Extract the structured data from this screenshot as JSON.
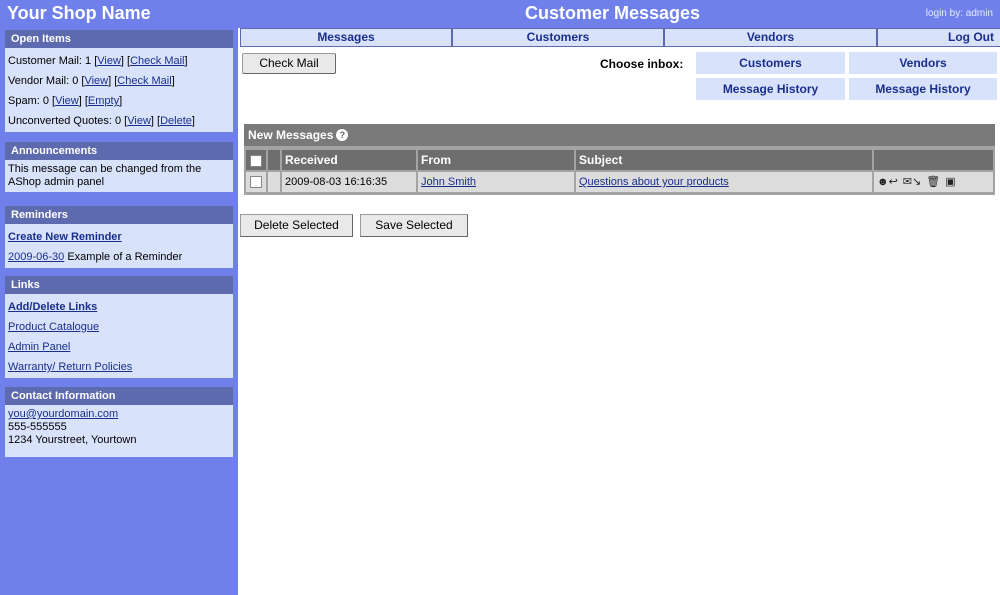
{
  "header": {
    "shop_name": "Your Shop Name",
    "page_title": "Customer Messages",
    "login": "login by: admin"
  },
  "sidebar": {
    "open_items": {
      "title": "Open Items",
      "customer_mail": "Customer Mail: 1",
      "vendor_mail": "Vendor Mail: 0",
      "spam": "Spam: 0",
      "unconverted": "Unconverted Quotes: 0",
      "view": "View",
      "check_mail": "Check Mail",
      "empty": "Empty",
      "delete": "Delete"
    },
    "announcements": {
      "title": "Announcements",
      "text": "This message can be changed from the AShop admin panel"
    },
    "reminders": {
      "title": "Reminders",
      "create": "Create New Reminder",
      "date": "2009-06-30",
      "example": "Example of a Reminder"
    },
    "links": {
      "title": "Links",
      "items": [
        "Add/Delete Links",
        "Product Catalogue",
        "Admin Panel",
        "Warranty/ Return Policies"
      ]
    },
    "contact": {
      "title": "Contact Information",
      "email": "you@yourdomain.com",
      "phone": "555-555555",
      "address": "1234 Yourstreet, Yourtown"
    }
  },
  "nav": {
    "tabs": [
      "Messages",
      "Customers",
      "Vendors",
      "Log Out"
    ]
  },
  "main": {
    "check_mail": "Check Mail",
    "choose_inbox": "Choose inbox:",
    "inbox_customers": "Customers",
    "inbox_vendors": "Vendors",
    "history_customers": "Message History",
    "history_vendors": "Message History",
    "table": {
      "title": "New Messages",
      "help": "?",
      "columns": [
        "Received",
        "From",
        "Subject"
      ],
      "rows": [
        {
          "received": "2009-08-03 16:16:35",
          "from": "John Smith",
          "subject": "Questions about your products"
        }
      ]
    },
    "delete_selected": "Delete Selected",
    "save_selected": "Save Selected"
  },
  "colors": {
    "accent": "#6f80ea",
    "panel_header": "#5e6aae",
    "panel_body": "#d8e2fa"
  }
}
